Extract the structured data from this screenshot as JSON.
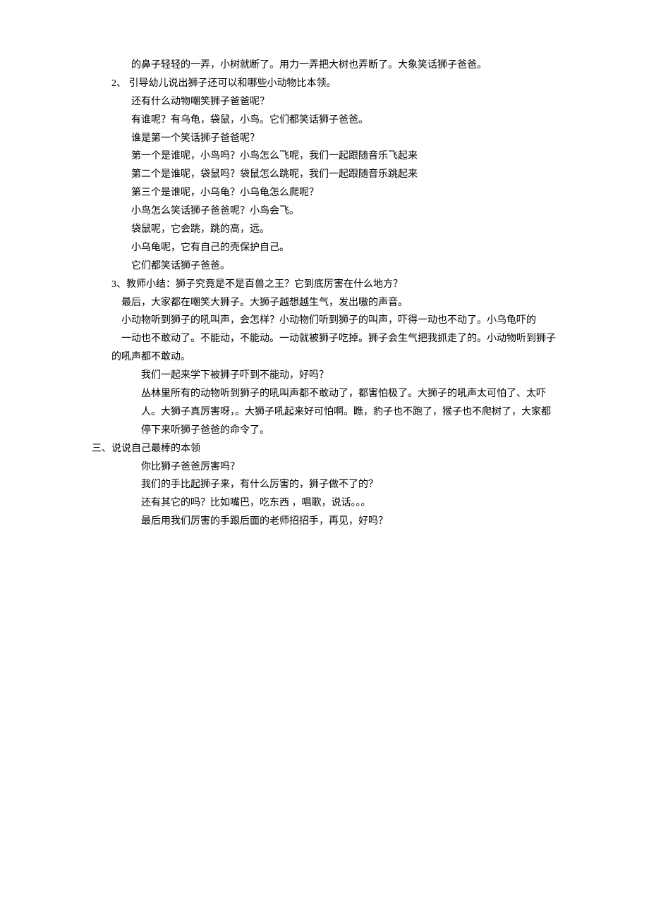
{
  "lines": [
    {
      "indent": 3,
      "text": "的鼻子轻轻的一弄，小树就断了。用力一弄把大树也弄断了。大象笑话狮子爸爸。"
    },
    {
      "indent": 1,
      "text": "2、 引导幼儿说出狮子还可以和哪些小动物比本领。"
    },
    {
      "indent": 3,
      "text": "还有什么动物嘲笑狮子爸爸呢？"
    },
    {
      "indent": 3,
      "text": "有谁呢？有乌龟，袋鼠，小鸟。它们都笑话狮子爸爸。"
    },
    {
      "indent": 3,
      "text": "谁是第一个笑话狮子爸爸呢？"
    },
    {
      "indent": 3,
      "text": "第一个是谁呢，小鸟吗？小鸟怎么飞呢，我们一起跟随音乐飞起来"
    },
    {
      "indent": 3,
      "text": "第二个是谁呢，袋鼠吗？袋鼠怎么跳呢，我们一起跟随音乐跳起来"
    },
    {
      "indent": 3,
      "text": "第三个是谁呢，小乌龟？小乌龟怎么爬呢？"
    },
    {
      "indent": 3,
      "text": "小鸟怎么笑话狮子爸爸呢？小鸟会飞。"
    },
    {
      "indent": 3,
      "text": "袋鼠呢，它会跳，跳的高，远。"
    },
    {
      "indent": 3,
      "text": "小乌龟呢，它有自己的壳保护自己。"
    },
    {
      "indent": 3,
      "text": "它们都笑话狮子爸爸。"
    },
    {
      "indent": 1,
      "text": "3、教师小结：狮子究竟是不是百兽之王？它到底厉害在什么地方？"
    },
    {
      "indent": 2,
      "text": "最后，大家都在嘲笑大狮子。大狮子越想越生气，发出嗷的声音。"
    },
    {
      "indent": 2,
      "text": "小动物听到狮子的吼叫声，会怎样？小动物们听到狮子的叫声，吓得一动也不动了。小乌龟吓的"
    },
    {
      "indent": 2,
      "text": "一动也不敢动了。不能动，不能动。一动就被狮子吃掉。狮子会生气把我抓走了的。小动物听到狮子"
    },
    {
      "indent": 1,
      "text": "的吼声都不敢动。"
    },
    {
      "indent": 4,
      "text": "我们一起来学下被狮子吓到不能动，好吗？"
    },
    {
      "indent": 4,
      "text": "丛林里所有的动物听到狮子的吼叫声都不敢动了，都害怕极了。大狮子的吼声太可怕了、太吓"
    },
    {
      "indent": 4,
      "text": "人。大狮子真厉害呀，。大狮子吼起来好可怕啊。瞧，豹子也不跑了，猴子也不爬树了，大家都"
    },
    {
      "indent": 4,
      "text": "停下来听狮子爸爸的命令了。"
    },
    {
      "indent": 0,
      "text": "三、说说自己最棒的本领"
    },
    {
      "indent": 4,
      "text": "你比狮子爸爸厉害吗？"
    },
    {
      "indent": 4,
      "text": "我们的手比起狮子来，有什么厉害的，狮子做不了的？"
    },
    {
      "indent": 4,
      "text": "还有其它的吗？比如嘴巴，吃东西 ，唱歌，说话。。。"
    },
    {
      "indent": 4,
      "text": "最后用我们厉害的手跟后面的老师招招手，再见，好吗？"
    }
  ]
}
